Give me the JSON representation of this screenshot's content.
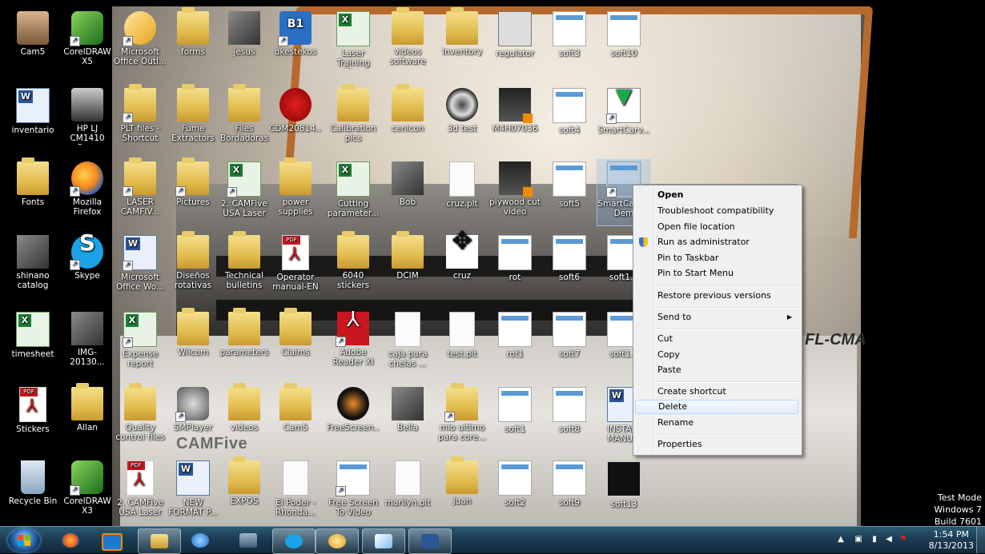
{
  "desktop": {
    "icons": [
      {
        "label": "Cam5"
      },
      {
        "label": "CorelDRAW X5"
      },
      {
        "label": "Microsoft Office Outl..."
      },
      {
        "label": "forms"
      },
      {
        "label": "jesus"
      },
      {
        "label": "dkestekos"
      },
      {
        "label": "Laser Training Plan"
      },
      {
        "label": "videos software"
      },
      {
        "label": "Inventory"
      },
      {
        "label": "regulator"
      },
      {
        "label": "soft3"
      },
      {
        "label": "soft10"
      },
      {
        "label": "inventario"
      },
      {
        "label": "HP LJ CM1410 Scan"
      },
      {
        "label": "PLT files - Shortcut"
      },
      {
        "label": "Fume Extractors"
      },
      {
        "label": "Files Bordadoras"
      },
      {
        "label": "CDM20814..."
      },
      {
        "label": "Calibration pics"
      },
      {
        "label": "cenicon"
      },
      {
        "label": "3d test"
      },
      {
        "label": "M4H07036"
      },
      {
        "label": "soft4"
      },
      {
        "label": "SmartCarv..."
      },
      {
        "label": "Fonts"
      },
      {
        "label": "Mozilla Firefox"
      },
      {
        "label": "LASER CAMFIV..."
      },
      {
        "label": "Pictures"
      },
      {
        "label": "2. CAMFive USA Laser ..."
      },
      {
        "label": "power supplies"
      },
      {
        "label": "Cutting parameter..."
      },
      {
        "label": "Bob"
      },
      {
        "label": "cruz.plt"
      },
      {
        "label": "plywood cut video"
      },
      {
        "label": "soft5"
      },
      {
        "label": "SmartCa... 3 Dem"
      },
      {
        "label": "shinano catalog"
      },
      {
        "label": "Skype"
      },
      {
        "label": "Microsoft Office Wo..."
      },
      {
        "label": "Diseños rotativas"
      },
      {
        "label": "Technical bulletins"
      },
      {
        "label": "Operator manual-EN"
      },
      {
        "label": "6040 stickers"
      },
      {
        "label": "DCIM"
      },
      {
        "label": "cruz"
      },
      {
        "label": "rot"
      },
      {
        "label": "soft6"
      },
      {
        "label": "soft1..."
      },
      {
        "label": "timesheet"
      },
      {
        "label": "IMG-20130..."
      },
      {
        "label": "Expense report"
      },
      {
        "label": "Wilcom"
      },
      {
        "label": "parameters"
      },
      {
        "label": "Claims"
      },
      {
        "label": "Adobe Reader XI"
      },
      {
        "label": "caja para chelas ..."
      },
      {
        "label": "test.plt"
      },
      {
        "label": "rot1"
      },
      {
        "label": "soft7"
      },
      {
        "label": "soft1..."
      },
      {
        "label": "Stickers"
      },
      {
        "label": "Allan"
      },
      {
        "label": "Quality control files"
      },
      {
        "label": "SMPlayer"
      },
      {
        "label": "videos"
      },
      {
        "label": "Cam5"
      },
      {
        "label": "FreeScreen..."
      },
      {
        "label": "Bella"
      },
      {
        "label": "mio ultimo para core..."
      },
      {
        "label": "soft1"
      },
      {
        "label": "soft8"
      },
      {
        "label": "INSTALL MANU..."
      },
      {
        "label": "Recycle Bin"
      },
      {
        "label": "CorelDRAW X3"
      },
      {
        "label": "2. CAMFive USA Laser ..."
      },
      {
        "label": "NEW FORMAT P..."
      },
      {
        "label": "EXPOS"
      },
      {
        "label": "El Poder - Rhonda..."
      },
      {
        "label": "Free Screen To Video"
      },
      {
        "label": "marilyn.plt"
      },
      {
        "label": "Juan"
      },
      {
        "label": "soft2"
      },
      {
        "label": "soft9"
      },
      {
        "label": "soft13"
      }
    ]
  },
  "wallpaper": {
    "brand_text": "CAMFive",
    "machine_text": "FL-CMA"
  },
  "context_menu": {
    "items": {
      "open": "Open",
      "troubleshoot": "Troubleshoot compatibility",
      "open_location": "Open file location",
      "run_admin": "Run as administrator",
      "pin_taskbar": "Pin to Taskbar",
      "pin_start": "Pin to Start Menu",
      "restore": "Restore previous versions",
      "send_to": "Send to",
      "cut": "Cut",
      "copy": "Copy",
      "paste": "Paste",
      "create_shortcut": "Create shortcut",
      "delete": "Delete",
      "rename": "Rename",
      "properties": "Properties"
    },
    "highlighted": "Delete"
  },
  "watermark": {
    "line1": "Test Mode",
    "line2": "Windows 7",
    "line3": "Build 7601"
  },
  "taskbar": {
    "clock_time": "1:54 PM",
    "clock_date": "8/13/2013",
    "pinned": [
      "firefox-icon",
      "media-player-icon",
      "file-explorer-icon",
      "internet-explorer-icon",
      "network-icon",
      "skype-icon",
      "outlook-icon",
      "paint-icon",
      "word-icon"
    ]
  },
  "colors": {
    "taskbar": "#1c3c52",
    "menu_bg": "#f0f0f0",
    "menu_highlight": "#e2eefc",
    "folder": "#e2bd4f"
  }
}
